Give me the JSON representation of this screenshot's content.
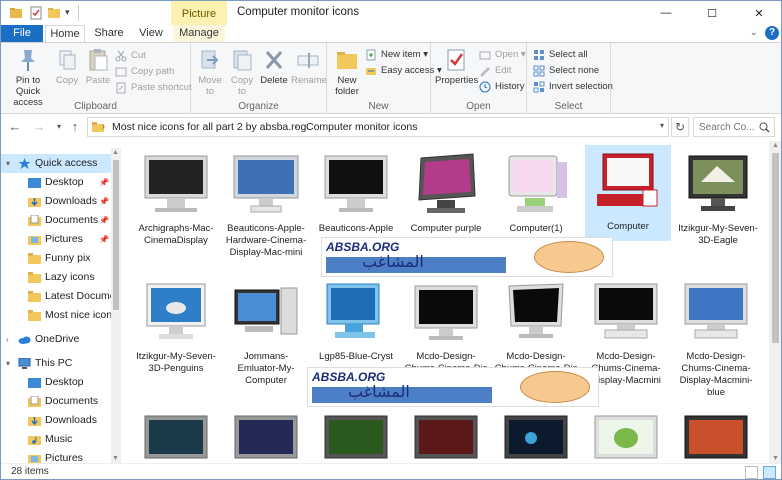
{
  "window": {
    "title": "Computer monitor icons",
    "context_tab": "Picture Tools",
    "controls": {
      "minimize": "—",
      "maximize": "☐",
      "close": "✕"
    }
  },
  "ribbon_tabs": [
    "File",
    "Home",
    "Share",
    "View",
    "Manage"
  ],
  "ribbon": {
    "clipboard": {
      "label": "Clipboard",
      "pin": "Pin to Quick access",
      "copy": "Copy",
      "paste": "Paste",
      "cut": "Cut",
      "copy_path": "Copy path",
      "paste_shortcut": "Paste shortcut"
    },
    "organize": {
      "label": "Organize",
      "move_to": "Move to",
      "copy_to": "Copy to",
      "delete": "Delete",
      "rename": "Rename"
    },
    "new": {
      "label": "New",
      "new_folder": "New folder",
      "new_item": "New item",
      "easy_access": "Easy access"
    },
    "open": {
      "label": "Open",
      "properties": "Properties",
      "open": "Open",
      "edit": "Edit",
      "history": "History"
    },
    "select": {
      "label": "Select",
      "select_all": "Select all",
      "select_none": "Select none",
      "invert": "Invert selection"
    }
  },
  "address": {
    "crumbs": [
      "Most nice icons for all part 2 by absba.rog",
      "Computer monitor icons"
    ],
    "search_placeholder": "Search Co..."
  },
  "nav": {
    "quick_access": "Quick access",
    "quick_items": [
      "Desktop",
      "Downloads",
      "Documents",
      "Pictures",
      "Funny pix",
      "Lazy icons",
      "Latest Documents",
      "Most nice icons f"
    ],
    "onedrive": "OneDrive",
    "this_pc": "This PC",
    "pc_items": [
      "Desktop",
      "Documents",
      "Downloads",
      "Music",
      "Pictures",
      "Videos"
    ]
  },
  "files": [
    {
      "name": "Archigraphs-Mac-CinemaDisplay"
    },
    {
      "name": "Beauticons-Apple-Hardware-Cinema-Display-Mac-mini"
    },
    {
      "name": "Beauticons-Apple"
    },
    {
      "name": "Computer purple"
    },
    {
      "name": "Computer(1)"
    },
    {
      "name": "Computer"
    },
    {
      "name": "Itzikgur-My-Seven-3D-Eagle"
    },
    {
      "name": "Itzikgur-My-Seven-3D-Penguins"
    },
    {
      "name": "Jommans-Emluator-My-Computer"
    },
    {
      "name": "Lgp85-Blue-Cryst"
    },
    {
      "name": "Mcdo-Design-Chums-Cinema-Dis"
    },
    {
      "name": "Mcdo-Design-Chums-Cinema-Dis"
    },
    {
      "name": "Mcdo-Design-Chums-Cinema-Display-Macmini"
    },
    {
      "name": "Mcdo-Design-Chums-Cinema-Display-Macmini-blue"
    }
  ],
  "watermark": {
    "text": "ABSBA.ORG",
    "arabic": "المشاغب"
  },
  "status": {
    "count": "28 items"
  }
}
